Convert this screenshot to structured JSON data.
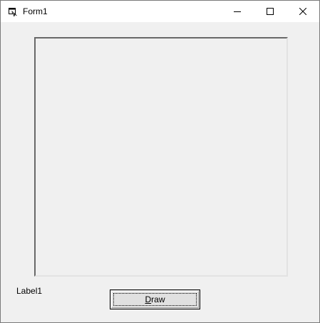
{
  "window": {
    "title": "Form1",
    "icon": "form-icon",
    "controls": {
      "minimize": "minimize-icon",
      "maximize": "maximize-icon",
      "close": "close-icon"
    }
  },
  "form": {
    "picturebox": "",
    "label1_text": "Label1",
    "draw_button": {
      "accelerator": "D",
      "rest": "raw"
    }
  },
  "colors": {
    "form_background": "#f0f0f0",
    "titlebar_background": "#ffffff",
    "button_face": "#e1e1e1"
  }
}
